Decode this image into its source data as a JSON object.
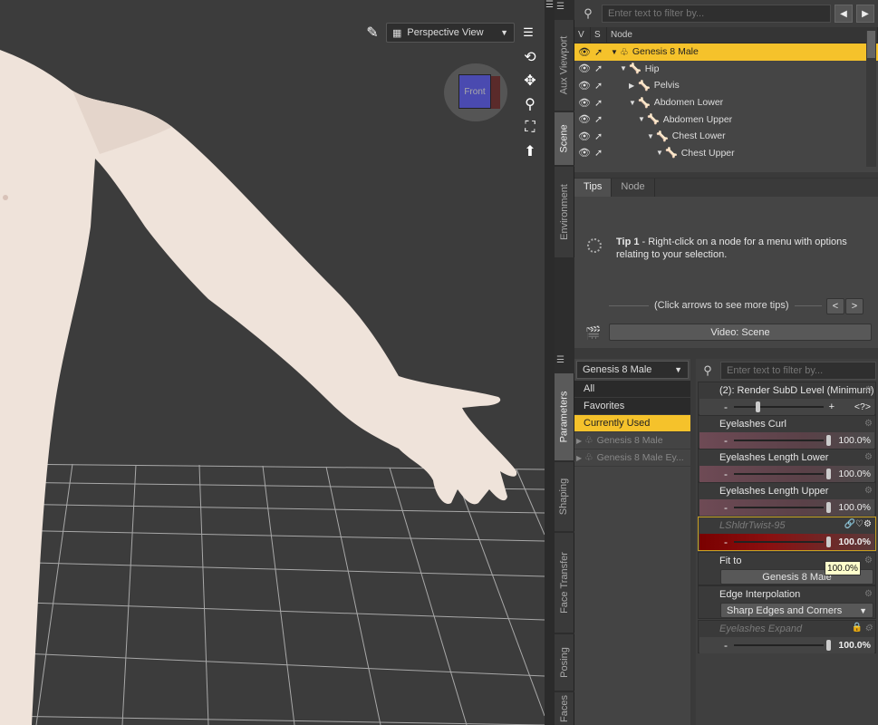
{
  "viewport": {
    "view_label": "Perspective View",
    "cube_label": "Front"
  },
  "side_tabs_top": [
    "Aux Viewport",
    "Scene",
    "Environment"
  ],
  "side_tabs_bottom": [
    "Parameters",
    "Shaping",
    "Face Transfer",
    "Posing",
    "Faces"
  ],
  "scene": {
    "filter_placeholder": "Enter text to filter by...",
    "col_v": "V",
    "col_s": "S",
    "col_node": "Node",
    "nodes": [
      {
        "label": "Genesis 8 Male",
        "selected": true
      },
      {
        "label": "Hip"
      },
      {
        "label": "Pelvis"
      },
      {
        "label": "Abdomen Lower"
      },
      {
        "label": "Abdomen Upper"
      },
      {
        "label": "Chest Lower"
      },
      {
        "label": "Chest Upper"
      }
    ]
  },
  "tips": {
    "tab_tips": "Tips",
    "tab_node": "Node",
    "tip_title": "Tip 1",
    "tip_text": " - Right-click on a node for a menu with options relating to your selection.",
    "click_arrows": "(Click arrows to see more tips)",
    "video_button": "Video: Scene"
  },
  "params": {
    "figure": "Genesis 8 Male",
    "categories": [
      "All",
      "Favorites",
      "Currently Used"
    ],
    "subitems": [
      "Genesis 8 Male",
      "Genesis 8 Male Ey..."
    ],
    "filter_placeholder": "Enter text to filter by...",
    "properties": {
      "subd": {
        "name": "(2): Render SubD Level (Minimum)",
        "value": "<?>"
      },
      "curl": {
        "name": "Eyelashes Curl",
        "value": "100.0%"
      },
      "len_lower": {
        "name": "Eyelashes Length Lower",
        "value": "100.0%"
      },
      "len_upper": {
        "name": "Eyelashes Length Upper",
        "value": "100.0%"
      },
      "twist": {
        "name": "LShldrTwist-95",
        "value": "100.0%"
      },
      "fit_to": {
        "name": "Fit to",
        "value": "Genesis 8 Male"
      },
      "edge": {
        "name": "Edge Interpolation",
        "value": "Sharp Edges and Corners"
      },
      "expand": {
        "name": "Eyelashes Expand",
        "value": "100.0%"
      }
    },
    "tooltip": "100.0%"
  }
}
